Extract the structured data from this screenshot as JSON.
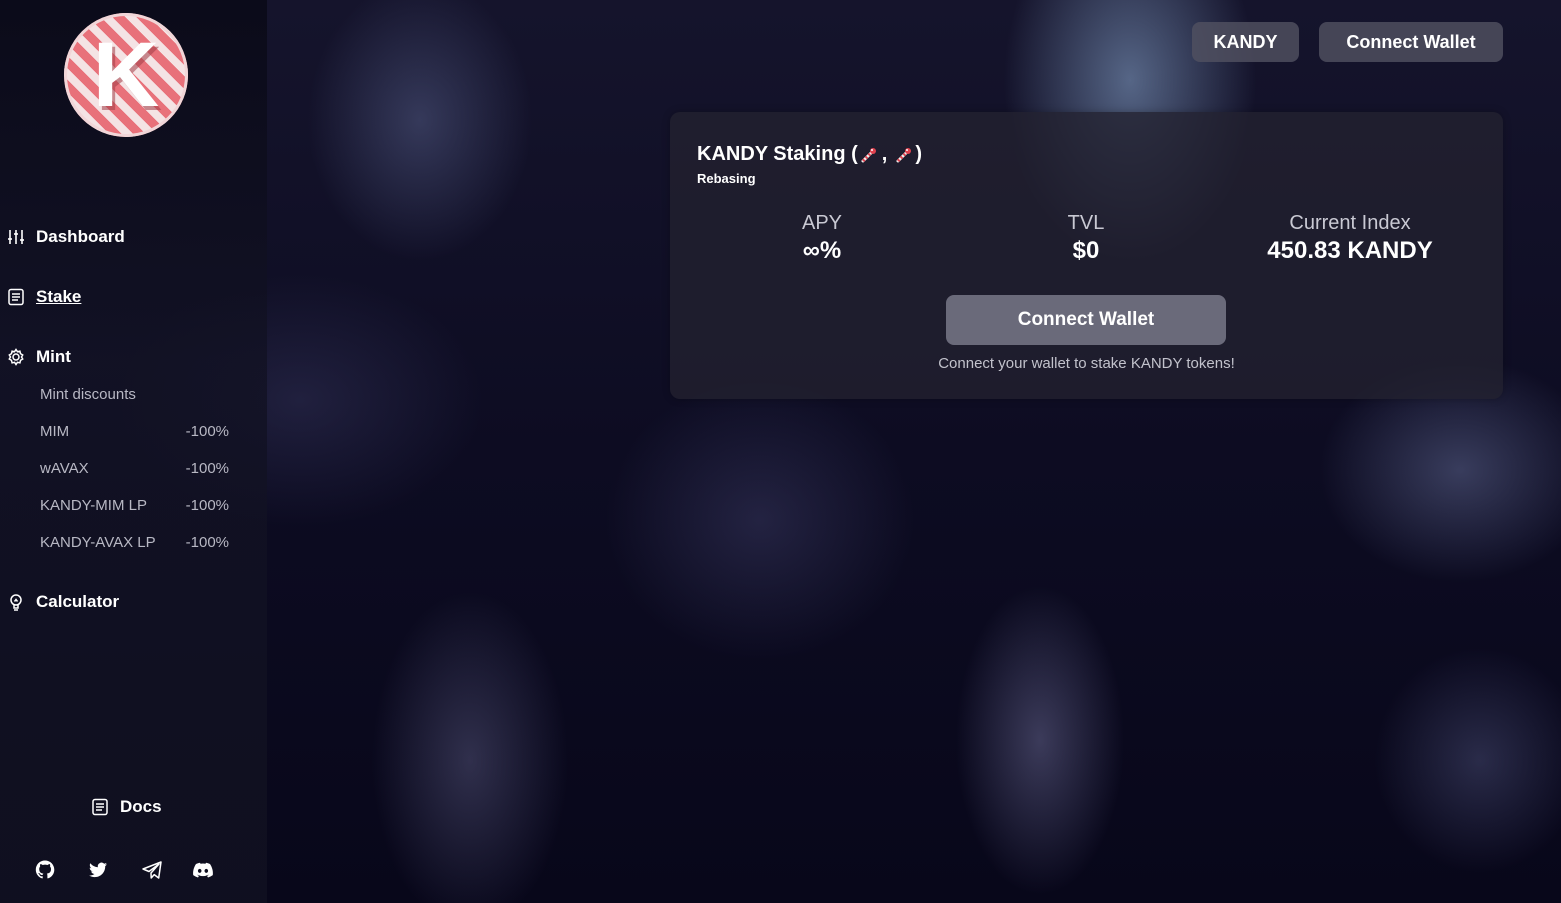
{
  "app": {
    "logo_letter": "K"
  },
  "sidebar": {
    "items": [
      {
        "label": "Dashboard",
        "icon": "sliders-icon"
      },
      {
        "label": "Stake",
        "icon": "document-icon"
      },
      {
        "label": "Mint",
        "icon": "gear-icon"
      },
      {
        "label": "Calculator",
        "icon": "lightbulb-icon"
      }
    ],
    "mint_discounts": {
      "heading": "Mint discounts",
      "rows": [
        {
          "name": "MIM",
          "value": "-100%"
        },
        {
          "name": "wAVAX",
          "value": "-100%"
        },
        {
          "name": "KANDY-MIM LP",
          "value": "-100%"
        },
        {
          "name": "KANDY-AVAX LP",
          "value": "-100%"
        }
      ]
    },
    "docs_label": "Docs",
    "social_icons": [
      "github-icon",
      "twitter-icon",
      "telegram-icon",
      "discord-icon"
    ]
  },
  "header": {
    "token_button": "KANDY",
    "connect_button": "Connect Wallet"
  },
  "staking": {
    "title_prefix": "KANDY Staking (",
    "title_separator": ",",
    "title_suffix": ")",
    "subtitle": "Rebasing",
    "metrics": [
      {
        "label": "APY",
        "value": "∞%"
      },
      {
        "label": "TVL",
        "value": "$0"
      },
      {
        "label": "Current Index",
        "value": "450.83 KANDY"
      }
    ],
    "connect_button": "Connect Wallet",
    "note": "Connect your wallet to stake KANDY tokens!"
  },
  "colors": {
    "background": "#0b0a1e",
    "card": "#222130",
    "button": "#505060",
    "logo_red": "#e8717a"
  }
}
